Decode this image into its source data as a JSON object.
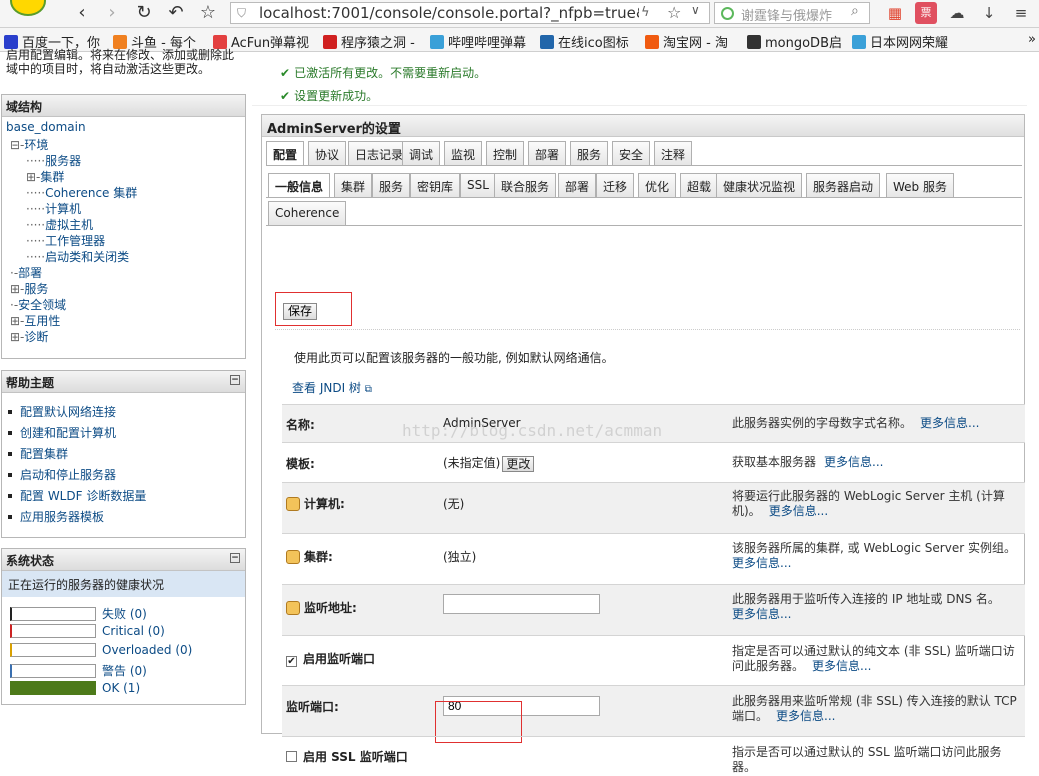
{
  "browser": {
    "url": "localhost:7001/console/console.portal?_nfpb=true&",
    "search_placeholder": "谢霆锋与俄爆炸",
    "bookmarks": [
      {
        "label": "百度一下，你",
        "icon": "paw-icon",
        "color": "#2a3fcc"
      },
      {
        "label": "斗鱼 - 每个",
        "icon": "douyu-icon",
        "color": "#f08020"
      },
      {
        "label": "AcFun弹幕视",
        "icon": "acfun-icon",
        "color": "#e34040"
      },
      {
        "label": "程序猿之洞 -",
        "icon": "c-icon",
        "color": "#d02020"
      },
      {
        "label": "哔哩哔哩弹幕",
        "icon": "tv-icon",
        "color": "#3aa0d8"
      },
      {
        "label": "在线ico图标",
        "icon": "ico-icon",
        "color": "#2266aa"
      },
      {
        "label": "淘宝网 - 淘",
        "icon": "taobao-icon",
        "color": "#f05a10"
      },
      {
        "label": "mongoDB启",
        "icon": "braces-icon",
        "color": "#333333"
      },
      {
        "label": "日本网网荣耀",
        "icon": "tv-icon",
        "color": "#3aa0d8"
      }
    ],
    "more_glyph": "»"
  },
  "sidebar": {
    "top_note_lines": [
      "启用配置编辑。将来在修改、添加或删除此",
      "域中的项目时，将自动激活这些更改。"
    ],
    "domain_panel": {
      "title": "域结构",
      "root": "base_domain",
      "tree": [
        {
          "label": "环境",
          "prefix": "⊟-"
        },
        {
          "label": "服务器",
          "prefix": "·····"
        },
        {
          "label": "集群",
          "prefix": "⊞-"
        },
        {
          "label": "Coherence 集群",
          "prefix": "·····"
        },
        {
          "label": "计算机",
          "prefix": "·····"
        },
        {
          "label": "虚拟主机",
          "prefix": "·····"
        },
        {
          "label": "工作管理器",
          "prefix": "·····"
        },
        {
          "label": "启动类和关闭类",
          "prefix": "·····"
        },
        {
          "label": "部署",
          "prefix": "·-"
        },
        {
          "label": "服务",
          "prefix": "⊞-"
        },
        {
          "label": "安全领域",
          "prefix": "·-"
        },
        {
          "label": "互用性",
          "prefix": "⊞-"
        },
        {
          "label": "诊断",
          "prefix": "⊞-"
        }
      ]
    },
    "help_panel": {
      "title": "帮助主题",
      "items": [
        "配置默认网络连接",
        "创建和配置计算机",
        "配置集群",
        "启动和停止服务器",
        "配置 WLDF 诊断数据量",
        "应用服务器模板"
      ]
    },
    "status_panel": {
      "title": "系统状态",
      "subtitle": "正在运行的服务器的健康状况",
      "rows": [
        {
          "label": "失败 (0)",
          "accent": "#222222",
          "fill": 0
        },
        {
          "label": "Critical (0)",
          "accent": "#cc2222",
          "fill": 0
        },
        {
          "label": "Overloaded (0)",
          "accent": "#d9a000",
          "fill": 0
        },
        {
          "label": "警告 (0)",
          "accent": "#3a6fb0",
          "fill": 0
        },
        {
          "label": "OK (1)",
          "accent": "#4d7a1a",
          "fill": 1
        }
      ]
    }
  },
  "main": {
    "messages": [
      "已激活所有更改。不需要重新启动。",
      "设置更新成功。"
    ],
    "panel_title": "AdminServer的设置",
    "tabs_primary": [
      "配置",
      "协议",
      "日志记录",
      "调试",
      "监视",
      "控制",
      "部署",
      "服务",
      "安全",
      "注释"
    ],
    "tabs_secondary": [
      "一般信息",
      "集群",
      "服务",
      "密钥库",
      "SSL",
      "联合服务",
      "部署",
      "迁移",
      "优化",
      "超载",
      "健康状况监视",
      "服务器启动",
      "Web 服务"
    ],
    "tabs_tertiary": [
      "Coherence"
    ],
    "save_label": "保存",
    "description": "使用此页可以配置该服务器的一般功能, 例如默认网络通信。",
    "jndi_link": "查看 JNDI 树",
    "watermark": "http://blog.csdn.net/acmman",
    "more_info": "更多信息...",
    "fields": {
      "name": {
        "label": "名称:",
        "value": "AdminServer",
        "hint": "此服务器实例的字母数字式名称。"
      },
      "template": {
        "label": "模板:",
        "value": "(未指定值)",
        "button": "更改",
        "hint": "获取基本服务器"
      },
      "machine": {
        "label": "计算机:",
        "value": "(无)",
        "hint": "将要运行此服务器的 WebLogic Server 主机 (计算机)。"
      },
      "cluster": {
        "label": "集群:",
        "value": "(独立)",
        "hint": "该服务器所属的集群, 或 WebLogic Server 实例组。"
      },
      "listen_address": {
        "label": "监听地址:",
        "value": "",
        "hint": "此服务器用于监听传入连接的 IP 地址或 DNS 名。"
      },
      "listen_port_enabled": {
        "label": "启用监听端口",
        "checked": true,
        "hint": "指定是否可以通过默认的纯文本 (非 SSL) 监听端口访问此服务器。"
      },
      "listen_port": {
        "label": "监听端口:",
        "value": "80",
        "hint": "此服务器用来监听常规 (非 SSL) 传入连接的默认 TCP 端口。"
      },
      "ssl_port_enabled": {
        "label": "启用 SSL 监听端口",
        "checked": false,
        "hint": "指示是否可以通过默认的 SSL 监听端口访问此服务器。"
      }
    }
  }
}
